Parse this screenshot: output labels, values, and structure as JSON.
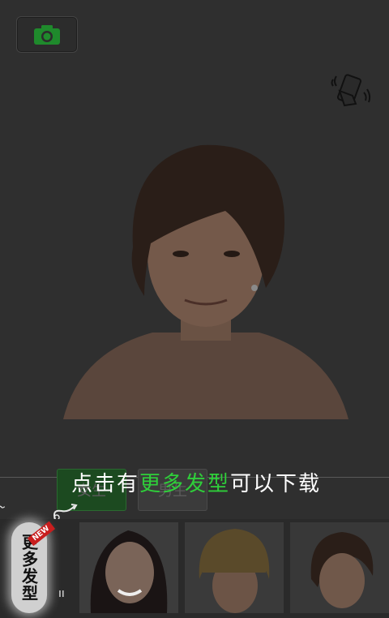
{
  "toolbar": {
    "camera_icon": "camera-icon",
    "shake_icon": "shake-phone-icon"
  },
  "tabs": [
    {
      "label": "女生",
      "selected": true
    },
    {
      "label": "男生",
      "selected": false
    }
  ],
  "hint": {
    "before": "点击有",
    "highlight": "更多发型",
    "after": "可以下载"
  },
  "more_button": {
    "label": "更多发型",
    "badge": "NEW"
  },
  "colors": {
    "accent_green": "#2fcf3a",
    "badge_red": "#c81e1e"
  }
}
